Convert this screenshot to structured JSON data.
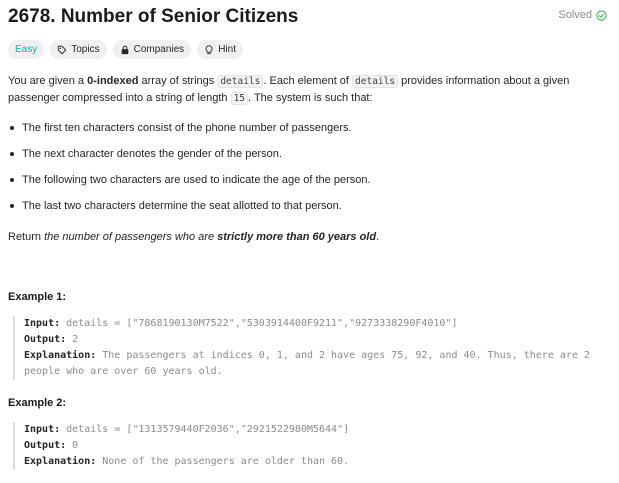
{
  "problem": {
    "title": "2678. Number of Senior Citizens",
    "status": "Solved",
    "status_color": "#2cbb5d",
    "difficulty_color": "#00b8a3"
  },
  "tags": {
    "difficulty": "Easy",
    "topics": "Topics",
    "companies": "Companies",
    "hint": "Hint"
  },
  "description": {
    "p1_a": "You are given a ",
    "p1_bold": "0-indexed",
    "p1_b": " array of strings ",
    "p1_code1": "details",
    "p1_c": ". Each element of ",
    "p1_code2": "details",
    "p1_d": " provides information about a given passenger compressed into a string of length ",
    "p1_code3": "15",
    "p1_e": ". The system is such that:",
    "rules": [
      "The first ten characters consist of the phone number of passengers.",
      "The next character denotes the gender of the person.",
      "The following two characters are used to indicate the age of the person.",
      "The last two characters determine the seat allotted to that person."
    ],
    "return_a": "Return ",
    "return_italic": "the number of passengers who are ",
    "return_bold": "strictly more than 60 years old",
    "return_b": "."
  },
  "examples": [
    {
      "heading": "Example 1:",
      "input_label": "Input:",
      "input_value": " details = [\"7868190130M7522\",\"5303914400F9211\",\"9273338290F4010\"]",
      "output_label": "Output:",
      "output_value": " 2",
      "explanation_label": "Explanation:",
      "explanation_value": " The passengers at indices 0, 1, and 2 have ages 75, 92, and 40. Thus, there are 2 people who are over 60 years old."
    },
    {
      "heading": "Example 2:",
      "input_label": "Input:",
      "input_value": " details = [\"1313579440F2036\",\"2921522980M5644\"]",
      "output_label": "Output:",
      "output_value": " 0",
      "explanation_label": "Explanation:",
      "explanation_value": " None of the passengers are older than 60."
    }
  ]
}
